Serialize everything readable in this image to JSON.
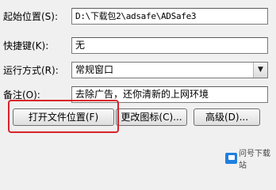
{
  "fields": {
    "start_in_label": "起始位置(S):",
    "start_in_value": "D:\\下载包2\\adsafe\\ADSafe3",
    "shortcut_key_label": "快捷键(K):",
    "shortcut_key_value": "无",
    "run_label": "运行方式(R):",
    "run_value": "常规窗口",
    "comment_label": "备注(O):",
    "comment_value": "去除广告，还你清新的上网环境"
  },
  "buttons": {
    "open_location": "打开文件位置(F)",
    "change_icon": "更改图标(C)...",
    "advanced": "高级(D)..."
  },
  "watermark": {
    "text": "问号下载站",
    "color": "#1f7fe0"
  },
  "colors": {
    "highlight": "#d8232a"
  }
}
